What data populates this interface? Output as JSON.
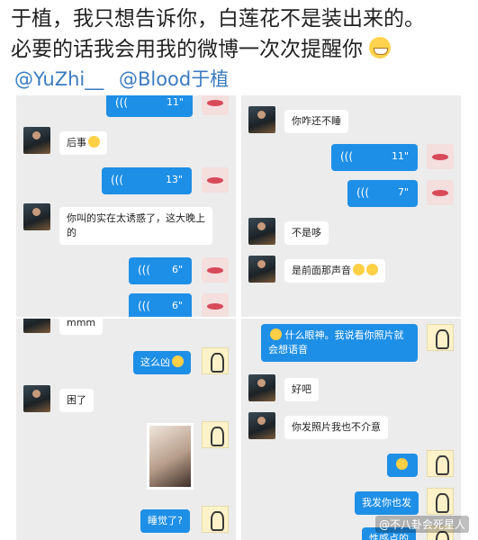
{
  "post": {
    "line1": "于植，我只想告诉你，白莲花不是装出来的。",
    "line2": "必要的话我会用我的微博一次次提醒你",
    "mentions": [
      "@YuZhi__",
      "@Blood于植"
    ]
  },
  "panel1": {
    "voice_top": "11\"",
    "msg1": "后事",
    "voice1": "13\"",
    "msg2": "你叫的实在太诱惑了，这大晚上的",
    "voice2": "6\"",
    "voice3": "6\""
  },
  "panel2": {
    "msg1": "你咋还不睡",
    "voice1": "11\"",
    "voice2": "7\"",
    "msg2": "不是哆",
    "msg3": "是前面那声音"
  },
  "panel3": {
    "msg_top": "mmm",
    "msg1": "这么凶",
    "msg2": "困了",
    "msg3": "睡觉了?"
  },
  "panel4": {
    "msg1": "什么眼神。我说看你照片就会想语音",
    "msg2": "好吧",
    "msg3": "你发照片我也不介意",
    "msg4": "我发你也发",
    "msg5": "性感点的"
  },
  "watermark": "@不八卦会死星人",
  "colors": {
    "bubble_blue": "#1e8fe6",
    "mention_blue": "#3b7bbf",
    "panel_bg": "#ececec"
  }
}
